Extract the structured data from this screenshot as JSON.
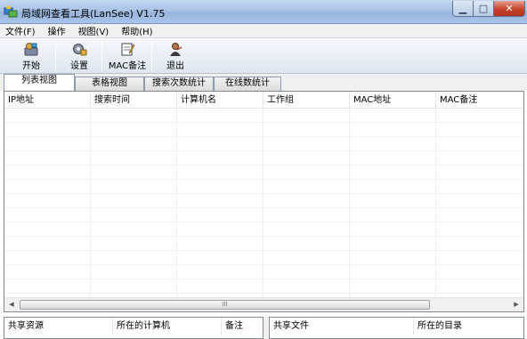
{
  "window": {
    "title": "局域网查看工具(LanSee) V1.75",
    "controls": {
      "minimize": "▁",
      "maximize": "□",
      "close": "✕"
    }
  },
  "menu": [
    "文件(F)",
    "操作",
    "视图(V)",
    "帮助(H)"
  ],
  "toolbar": [
    {
      "label": "开始",
      "icon": "start-icon"
    },
    {
      "label": "设置",
      "icon": "settings-icon"
    },
    {
      "label": "MAC备注",
      "icon": "mac-note-icon"
    },
    {
      "label": "退出",
      "icon": "exit-icon"
    }
  ],
  "tabs": [
    "列表视图",
    "表格视图",
    "搜索次数统计",
    "在线数统计"
  ],
  "active_tab": "列表视图",
  "list": {
    "columns": [
      "IP地址",
      "搜索时间",
      "计算机名",
      "工作组",
      "MAC地址",
      "MAC备注"
    ],
    "rows": []
  },
  "scrollbar": {
    "left": "◀",
    "right": "▶",
    "thumb": "III"
  },
  "shares_panel": {
    "columns": [
      "共享资源",
      "所在的计算机",
      "备注"
    ]
  },
  "files_panel": {
    "columns": [
      "共享文件",
      "所在的目录"
    ]
  },
  "colors": {
    "titlebar": "#a9c3e6",
    "close_button": "#c2422b",
    "toolbar": "#dfe6f0"
  }
}
